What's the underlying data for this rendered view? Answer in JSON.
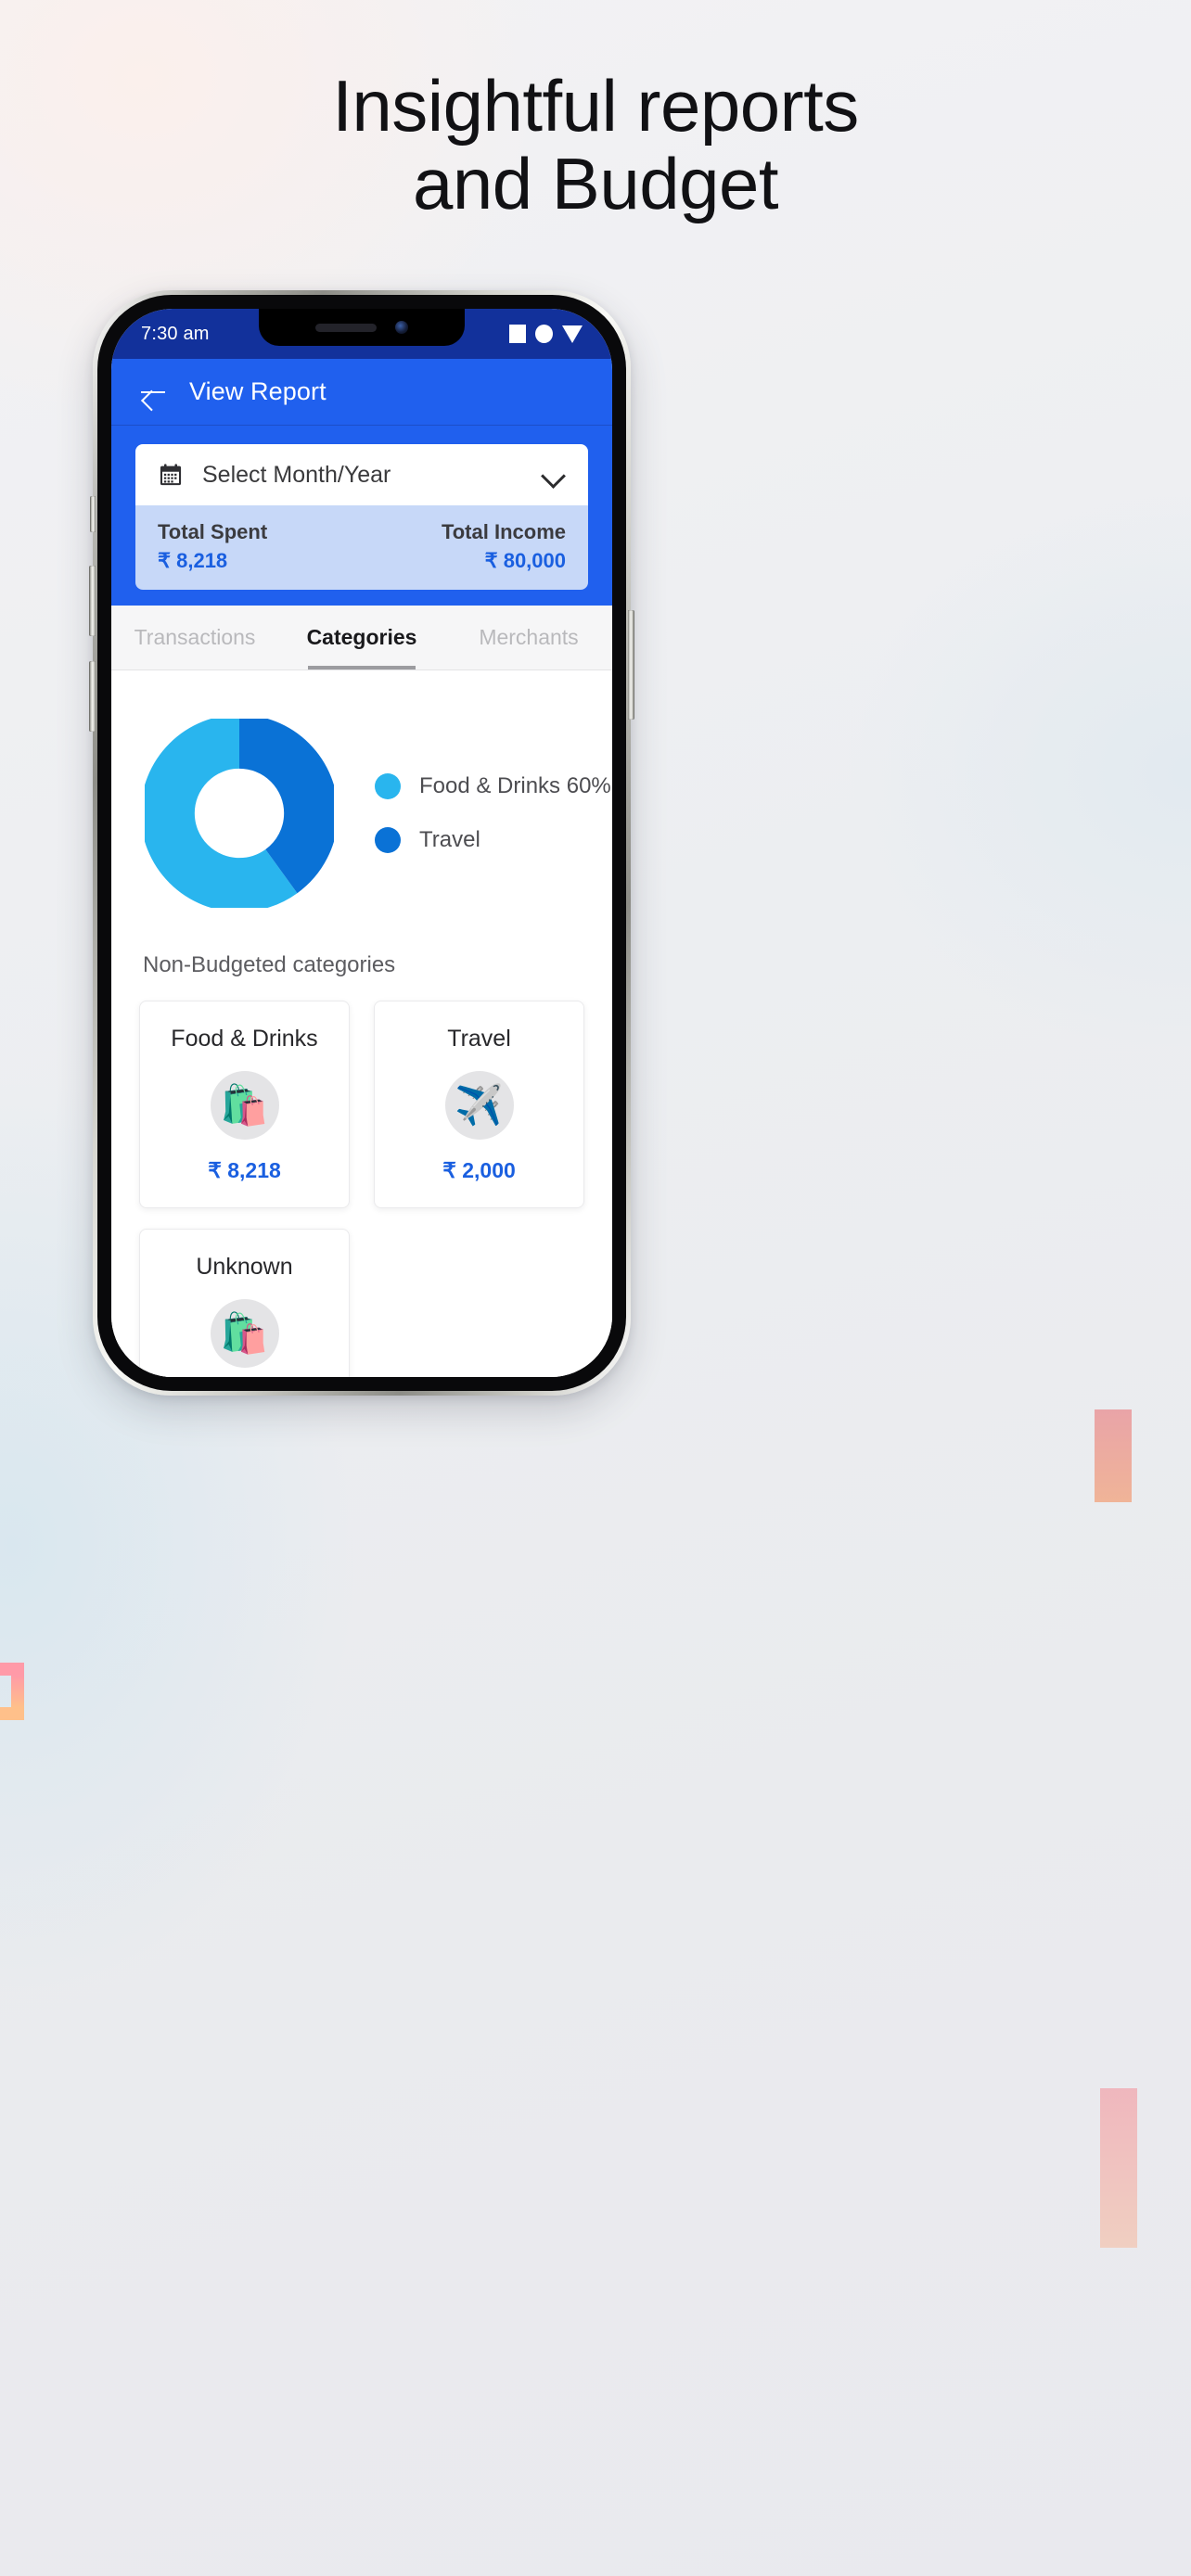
{
  "headline": {
    "line1": "Insightful reports",
    "line2": "and Budget"
  },
  "phone": {
    "status_bar": {
      "time": "7:30 am",
      "icons": [
        "square-icon",
        "circle-icon",
        "triangle-down-icon"
      ]
    },
    "app_bar": {
      "back_icon": "arrow-left-icon",
      "title": "View Report"
    },
    "summary": {
      "month_selector": {
        "icon": "calendar-icon",
        "label": "Select Month/Year",
        "chevron": "chevron-down-icon"
      },
      "total_spent_label": "Total Spent",
      "total_spent_value": "₹ 8,218",
      "total_income_label": "Total Income",
      "total_income_value": "₹ 80,000"
    },
    "tabs": [
      {
        "label": "Transactions",
        "active": false
      },
      {
        "label": "Categories",
        "active": true
      },
      {
        "label": "Merchants",
        "active": false
      }
    ],
    "non_budgeted_title": "Non-Budgeted categories",
    "category_cards": [
      {
        "name": "Food & Drinks",
        "emoji": "🛍️",
        "icon_name": "groceries-icon",
        "amount": "₹ 8,218"
      },
      {
        "name": "Travel",
        "emoji": "✈️",
        "icon_name": "airplane-icon",
        "amount": "₹ 2,000"
      },
      {
        "name": "Unknown",
        "emoji": "🛍️",
        "icon_name": "groceries-icon",
        "amount": ""
      }
    ]
  },
  "colors": {
    "brand_blue": "#2060ee",
    "status_bar_blue": "#12319b",
    "panel_light_blue": "#c7d8f8",
    "value_blue": "#1a5fe0",
    "donut_light": "#29b5ee",
    "donut_dark": "#0a72d6"
  },
  "chart_data": {
    "type": "pie",
    "title": "",
    "labels": [
      "Food & Drinks",
      "Travel"
    ],
    "values": [
      60,
      40
    ],
    "display_labels": [
      "Food & Drinks 60%",
      "Travel"
    ],
    "colors": [
      "#29b5ee",
      "#0a72d6"
    ],
    "donut": true,
    "inner_radius_ratio": 0.58,
    "legend_position": "right",
    "start_angle_deg": 0,
    "direction": "clockwise"
  }
}
